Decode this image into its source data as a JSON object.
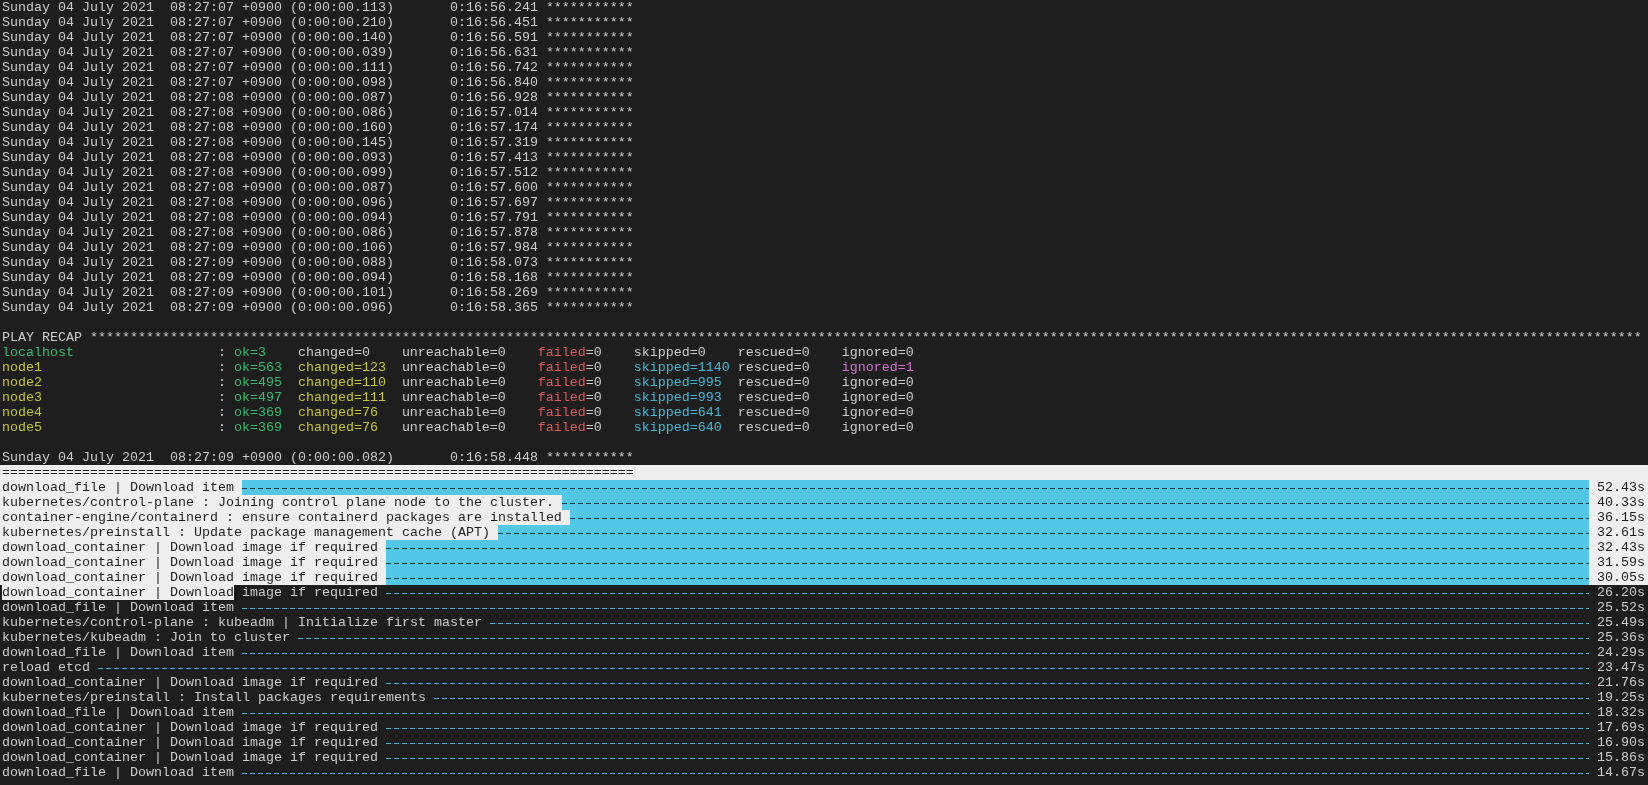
{
  "log_lines": [
    "Sunday 04 July 2021  08:27:07 +0900 (0:00:00.113)       0:16:56.241 ***********",
    "Sunday 04 July 2021  08:27:07 +0900 (0:00:00.210)       0:16:56.451 ***********",
    "Sunday 04 July 2021  08:27:07 +0900 (0:00:00.140)       0:16:56.591 ***********",
    "Sunday 04 July 2021  08:27:07 +0900 (0:00:00.039)       0:16:56.631 ***********",
    "Sunday 04 July 2021  08:27:07 +0900 (0:00:00.111)       0:16:56.742 ***********",
    "Sunday 04 July 2021  08:27:07 +0900 (0:00:00.098)       0:16:56.840 ***********",
    "Sunday 04 July 2021  08:27:08 +0900 (0:00:00.087)       0:16:56.928 ***********",
    "Sunday 04 July 2021  08:27:08 +0900 (0:00:00.086)       0:16:57.014 ***********",
    "Sunday 04 July 2021  08:27:08 +0900 (0:00:00.160)       0:16:57.174 ***********",
    "Sunday 04 July 2021  08:27:08 +0900 (0:00:00.145)       0:16:57.319 ***********",
    "Sunday 04 July 2021  08:27:08 +0900 (0:00:00.093)       0:16:57.413 ***********",
    "Sunday 04 July 2021  08:27:08 +0900 (0:00:00.099)       0:16:57.512 ***********",
    "Sunday 04 July 2021  08:27:08 +0900 (0:00:00.087)       0:16:57.600 ***********",
    "Sunday 04 July 2021  08:27:08 +0900 (0:00:00.096)       0:16:57.697 ***********",
    "Sunday 04 July 2021  08:27:08 +0900 (0:00:00.094)       0:16:57.791 ***********",
    "Sunday 04 July 2021  08:27:08 +0900 (0:00:00.086)       0:16:57.878 ***********",
    "Sunday 04 July 2021  08:27:09 +0900 (0:00:00.106)       0:16:57.984 ***********",
    "Sunday 04 July 2021  08:27:09 +0900 (0:00:00.088)       0:16:58.073 ***********",
    "Sunday 04 July 2021  08:27:09 +0900 (0:00:00.094)       0:16:58.168 ***********",
    "Sunday 04 July 2021  08:27:09 +0900 (0:00:00.101)       0:16:58.269 ***********",
    "Sunday 04 July 2021  08:27:09 +0900 (0:00:00.096)       0:16:58.365 ***********"
  ],
  "recap": {
    "header": "PLAY RECAP **************************************************************************************************************************************************************************************************",
    "hosts": [
      {
        "name": "localhost",
        "color": "#3cba6e",
        "separator": ":",
        "stats": [
          {
            "key": "ok",
            "value": "=3",
            "color": "#3cba6e",
            "value_tinted": true
          },
          {
            "key": "changed",
            "value": "=0"
          },
          {
            "key": "unreachable",
            "value": "=0"
          },
          {
            "key": "failed",
            "value": "=0",
            "color": "#e0585a",
            "value_tinted": false
          },
          {
            "key": "skipped",
            "value": "=0"
          },
          {
            "key": "rescued",
            "value": "=0"
          },
          {
            "key": "ignored",
            "value": "=0"
          }
        ]
      },
      {
        "name": "node1",
        "color": "#c5c540",
        "separator": ":",
        "stats": [
          {
            "key": "ok",
            "value": "=563",
            "color": "#3cba6e",
            "value_tinted": true
          },
          {
            "key": "changed",
            "value": "=123",
            "color": "#c5c540",
            "value_tinted": true
          },
          {
            "key": "unreachable",
            "value": "=0"
          },
          {
            "key": "failed",
            "value": "=0",
            "color": "#e0585a",
            "value_tinted": false
          },
          {
            "key": "skipped",
            "value": "=1140",
            "color": "#48b8d8",
            "value_tinted": true
          },
          {
            "key": "rescued",
            "value": "=0"
          },
          {
            "key": "ignored",
            "value": "=1",
            "color": "#d670d6",
            "value_tinted": true
          }
        ]
      },
      {
        "name": "node2",
        "color": "#c5c540",
        "separator": ":",
        "stats": [
          {
            "key": "ok",
            "value": "=495",
            "color": "#3cba6e",
            "value_tinted": true
          },
          {
            "key": "changed",
            "value": "=110",
            "color": "#c5c540",
            "value_tinted": true
          },
          {
            "key": "unreachable",
            "value": "=0"
          },
          {
            "key": "failed",
            "value": "=0",
            "color": "#e0585a",
            "value_tinted": false
          },
          {
            "key": "skipped",
            "value": "=995",
            "color": "#48b8d8",
            "value_tinted": true
          },
          {
            "key": "rescued",
            "value": "=0"
          },
          {
            "key": "ignored",
            "value": "=0"
          }
        ]
      },
      {
        "name": "node3",
        "color": "#c5c540",
        "separator": ":",
        "stats": [
          {
            "key": "ok",
            "value": "=497",
            "color": "#3cba6e",
            "value_tinted": true
          },
          {
            "key": "changed",
            "value": "=111",
            "color": "#c5c540",
            "value_tinted": true
          },
          {
            "key": "unreachable",
            "value": "=0"
          },
          {
            "key": "failed",
            "value": "=0",
            "color": "#e0585a",
            "value_tinted": false
          },
          {
            "key": "skipped",
            "value": "=993",
            "color": "#48b8d8",
            "value_tinted": true
          },
          {
            "key": "rescued",
            "value": "=0"
          },
          {
            "key": "ignored",
            "value": "=0"
          }
        ]
      },
      {
        "name": "node4",
        "color": "#c5c540",
        "separator": ":",
        "stats": [
          {
            "key": "ok",
            "value": "=369",
            "color": "#3cba6e",
            "value_tinted": true
          },
          {
            "key": "changed",
            "value": "=76",
            "color": "#c5c540",
            "value_tinted": true
          },
          {
            "key": "unreachable",
            "value": "=0"
          },
          {
            "key": "failed",
            "value": "=0",
            "color": "#e0585a",
            "value_tinted": false
          },
          {
            "key": "skipped",
            "value": "=641",
            "color": "#48b8d8",
            "value_tinted": true
          },
          {
            "key": "rescued",
            "value": "=0"
          },
          {
            "key": "ignored",
            "value": "=0"
          }
        ]
      },
      {
        "name": "node5",
        "color": "#c5c540",
        "separator": ":",
        "stats": [
          {
            "key": "ok",
            "value": "=369",
            "color": "#3cba6e",
            "value_tinted": true
          },
          {
            "key": "changed",
            "value": "=76",
            "color": "#c5c540",
            "value_tinted": true
          },
          {
            "key": "unreachable",
            "value": "=0"
          },
          {
            "key": "failed",
            "value": "=0",
            "color": "#e0585a",
            "value_tinted": false
          },
          {
            "key": "skipped",
            "value": "=640",
            "color": "#48b8d8",
            "value_tinted": true
          },
          {
            "key": "rescued",
            "value": "=0"
          },
          {
            "key": "ignored",
            "value": "=0"
          }
        ]
      }
    ]
  },
  "final_line": "Sunday 04 July 2021  08:27:09 +0900 (0:00:00.082)       0:16:58.448 ***********",
  "profile": {
    "rule": {
      "text": "===============================================================================",
      "selected": true
    },
    "rows": [
      {
        "kind": "whole",
        "task": "download_file | Download item",
        "time": "52.43s",
        "selected": true
      },
      {
        "kind": "whole",
        "task": "kubernetes/control-plane : Joining control plane node to the cluster.",
        "time": "40.33s",
        "selected": true
      },
      {
        "kind": "whole",
        "task": "container-engine/containerd : ensure containerd packages are installed",
        "time": "36.15s",
        "selected": true
      },
      {
        "kind": "whole",
        "task": "kubernetes/preinstall : Update package management cache (APT)",
        "time": "32.61s",
        "selected": true
      },
      {
        "kind": "whole",
        "task": "download_container | Download image if required",
        "time": "32.43s",
        "selected": true
      },
      {
        "kind": "whole",
        "task": "download_container | Download image if required",
        "time": "31.59s",
        "selected": true
      },
      {
        "kind": "whole",
        "task": "download_container | Download image if required",
        "time": "30.05s",
        "selected": true
      },
      {
        "kind": "split",
        "segments": [
          {
            "text": "download_container | Download",
            "selected": true
          },
          {
            "text": " image if required",
            "selected": false
          }
        ],
        "time": "26.20s"
      },
      {
        "kind": "whole",
        "task": "download_file | Download item",
        "time": "25.52s",
        "selected": false
      },
      {
        "kind": "whole",
        "task": "kubernetes/control-plane : kubeadm | Initialize first master",
        "time": "25.49s",
        "selected": false
      },
      {
        "kind": "whole",
        "task": "kubernetes/kubeadm : Join to cluster",
        "time": "25.36s",
        "selected": false
      },
      {
        "kind": "whole",
        "task": "download_file | Download item",
        "time": "24.29s",
        "selected": false
      },
      {
        "kind": "whole",
        "task": "reload etcd",
        "time": "23.47s",
        "selected": false
      },
      {
        "kind": "whole",
        "task": "download_container | Download image if required",
        "time": "21.76s",
        "selected": false
      },
      {
        "kind": "whole",
        "task": "kubernetes/preinstall : Install packages requirements",
        "time": "19.25s",
        "selected": false
      },
      {
        "kind": "whole",
        "task": "download_file | Download item",
        "time": "18.32s",
        "selected": false
      },
      {
        "kind": "whole",
        "task": "download_container | Download image if required",
        "time": "17.69s",
        "selected": false
      },
      {
        "kind": "whole",
        "task": "download_container | Download image if required",
        "time": "16.90s",
        "selected": false
      },
      {
        "kind": "whole",
        "task": "download_container | Download image if required",
        "time": "15.86s",
        "selected": false
      },
      {
        "kind": "whole",
        "task": "download_file | Download item",
        "time": "14.67s",
        "selected": false
      }
    ]
  }
}
